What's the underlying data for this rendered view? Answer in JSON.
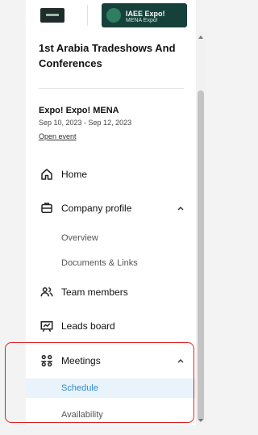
{
  "logos": {
    "partner_logo": "event organizer logo",
    "brand_text": "IAEE Expo!",
    "brand_sub": "MENA Expo!"
  },
  "exhibition": {
    "title": "1st Arabia Tradeshows And Conferences"
  },
  "event": {
    "name": "Expo! Expo! MENA",
    "dates": "Sep 10, 2023 - Sep 12, 2023",
    "open_link": "Open event"
  },
  "nav": {
    "home": {
      "label": "Home",
      "icon": "home-icon"
    },
    "company_profile": {
      "label": "Company profile",
      "icon": "company-icon",
      "expanded": true
    },
    "overview": {
      "label": "Overview"
    },
    "documents": {
      "label": "Documents & Links"
    },
    "team_members": {
      "label": "Team members",
      "icon": "team-icon"
    },
    "leads_board": {
      "label": "Leads board",
      "icon": "leads-board-icon"
    },
    "meetings": {
      "label": "Meetings",
      "icon": "meetings-icon",
      "expanded": true
    },
    "schedule": {
      "label": "Schedule",
      "active": true
    },
    "availability": {
      "label": "Availability"
    }
  },
  "colors": {
    "accent": "#2f8bd0",
    "active_bg": "#e9f3fb",
    "annotation": "#e0201e"
  }
}
